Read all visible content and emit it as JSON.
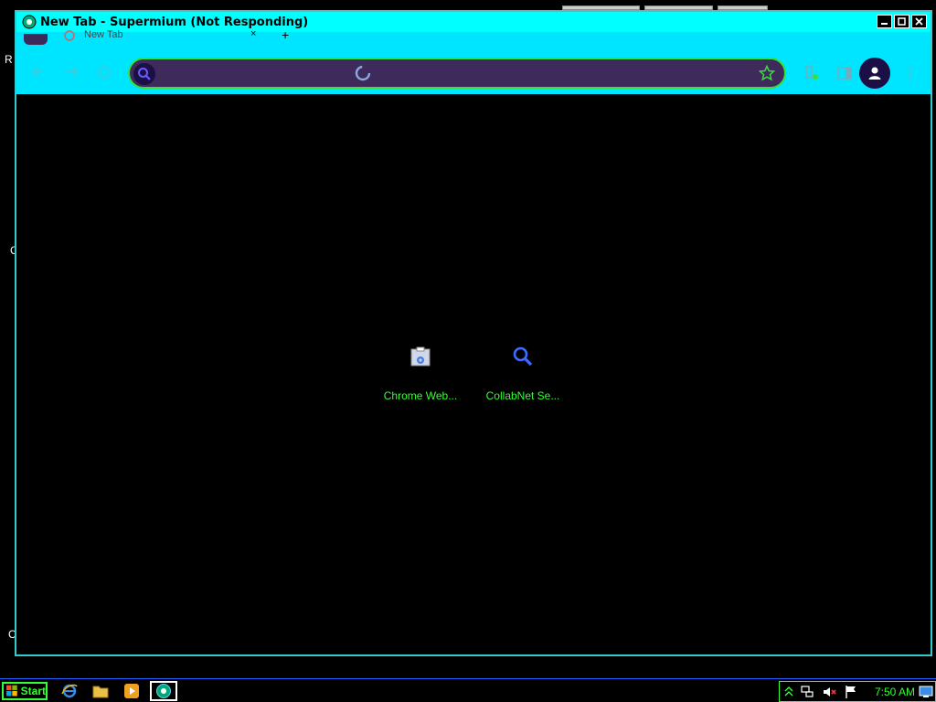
{
  "window": {
    "title": "New Tab - Supermium (Not Responding)"
  },
  "tab": {
    "label": "New Tab"
  },
  "omnibox": {
    "value": "",
    "placeholder": ""
  },
  "shortcuts": [
    {
      "label": "Chrome Web...",
      "icon": "web-store-icon"
    },
    {
      "label": "CollabNet Se...",
      "icon": "search-icon"
    }
  ],
  "taskbar": {
    "start_label": "Start",
    "clock": "7:50 AM"
  },
  "desktop": {
    "fragments": [
      "R",
      "C",
      "C"
    ]
  },
  "colors": {
    "titlebar": "#00ffff",
    "toolbar": "#00e5ff",
    "omnibox_bg": "#3f2a5c",
    "accent_green": "#33ff33",
    "link_green": "#33ff33"
  }
}
